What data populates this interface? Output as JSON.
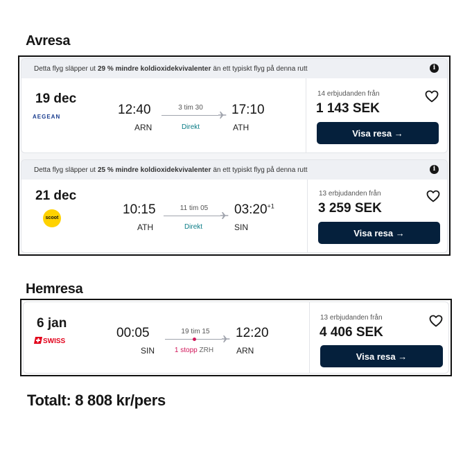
{
  "outbound": {
    "heading": "Avresa",
    "flights": [
      {
        "banner_pre": "Detta flyg släpper ut",
        "banner_bold": "29 % mindre koldioxidekvivalenter",
        "banner_post": "än ett typiskt flyg på denna rutt",
        "date": "19 dec",
        "airline": "AEGEAN",
        "dep_time": "12:40",
        "dep_airport": "ARN",
        "duration": "3 tim 30",
        "stops": "Direkt",
        "arr_time": "17:10",
        "arr_day_offset": "",
        "arr_airport": "ATH",
        "deals": "14 erbjudanden från",
        "price": "1 143 SEK",
        "button": "Visa resa →"
      },
      {
        "banner_pre": "Detta flyg släpper ut",
        "banner_bold": "25 % mindre koldioxidekvivalenter",
        "banner_post": "än ett typiskt flyg på denna rutt",
        "date": "21 dec",
        "airline": "scoot",
        "dep_time": "10:15",
        "dep_airport": "ATH",
        "duration": "11 tim 05",
        "stops": "Direkt",
        "arr_time": "03:20",
        "arr_day_offset": "+1",
        "arr_airport": "SIN",
        "deals": "13 erbjudanden från",
        "price": "3 259 SEK",
        "button": "Visa resa →"
      }
    ]
  },
  "return": {
    "heading": "Hemresa",
    "flights": [
      {
        "date": "6 jan",
        "airline": "SWISS",
        "dep_time": "00:05",
        "dep_airport": "SIN",
        "duration": "19 tim 15",
        "stops": "1 stopp",
        "stop_airport": "ZRH",
        "arr_time": "12:20",
        "arr_airport": "ARN",
        "deals": "13 erbjudanden från",
        "price": "4 406 SEK",
        "button": "Visa resa →"
      }
    ]
  },
  "total": "Totalt: 8 808 kr/pers",
  "icons": {
    "info": "info-icon",
    "favorite": "heart-outline-icon",
    "plane": "plane-icon"
  },
  "colors": {
    "button_bg": "#05203c",
    "direct": "#0a7c86",
    "stop": "#d1175a",
    "swiss_red": "#e2001a",
    "scoot_yellow": "#ffd200"
  }
}
